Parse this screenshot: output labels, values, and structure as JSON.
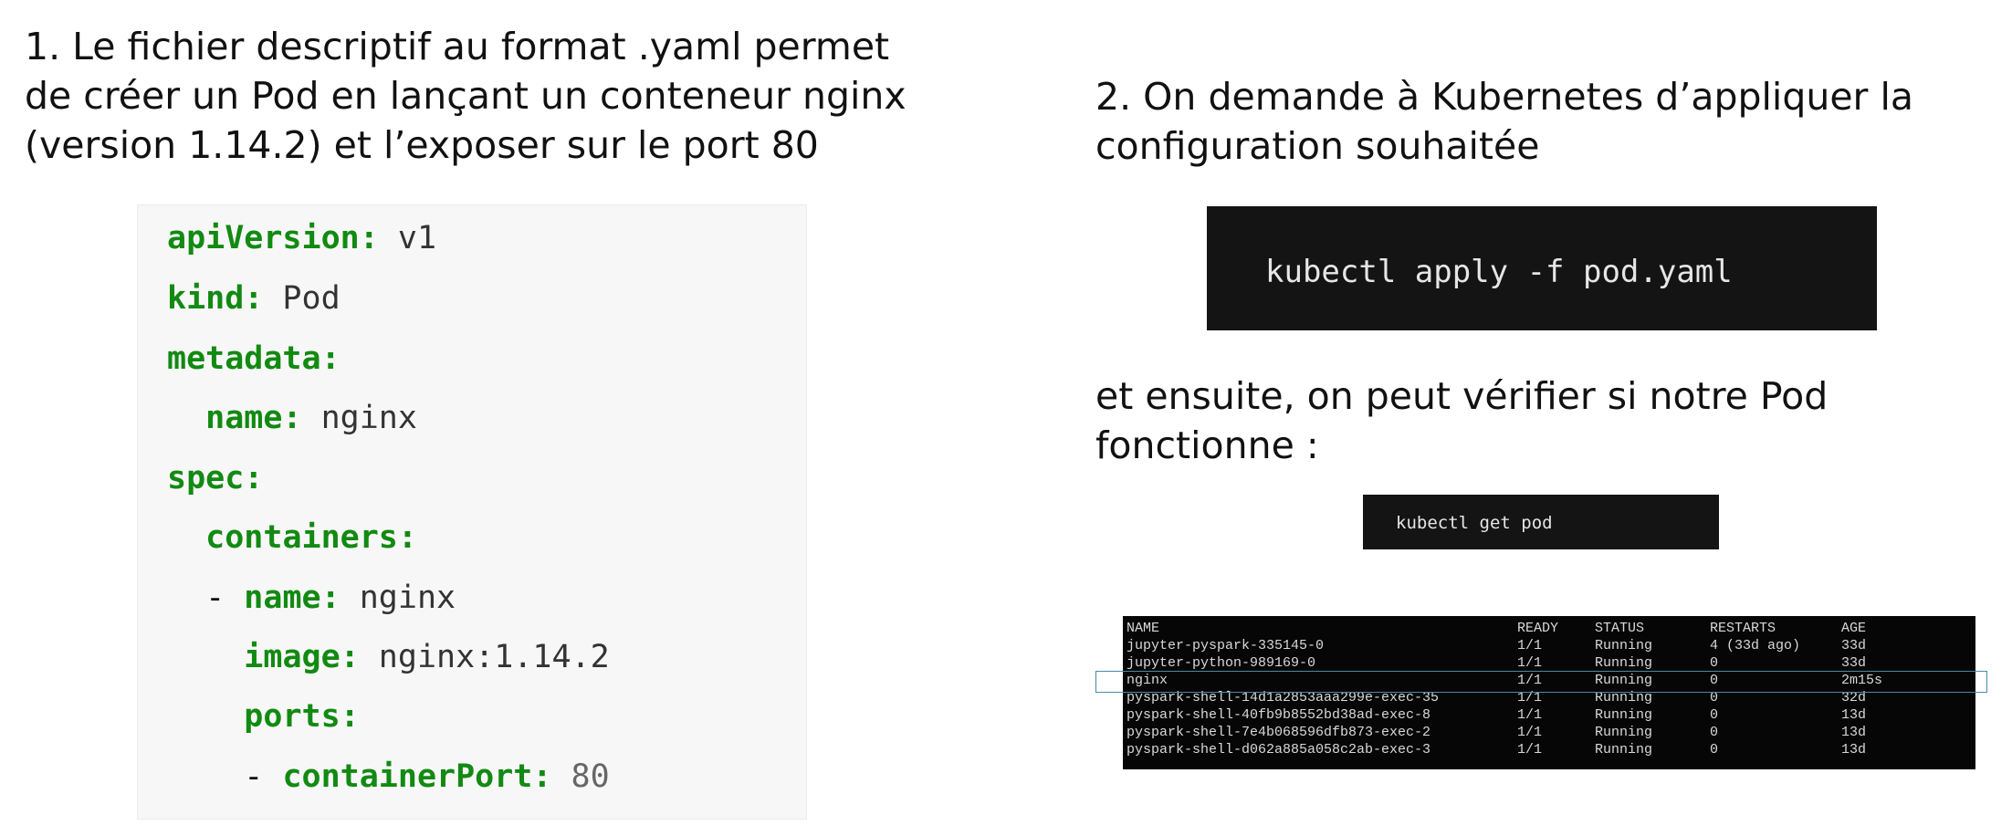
{
  "step1": {
    "lines": [
      "1. Le fichier descriptif au format .yaml permet",
      "de créer un Pod en lançant un conteneur nginx",
      "(version 1.14.2) et l’exposer sur le port 80"
    ]
  },
  "yaml": {
    "lines": [
      {
        "key": "apiVersion:",
        "value": " v1",
        "indent": ""
      },
      {
        "key": "kind:",
        "value": " Pod",
        "indent": ""
      },
      {
        "key": "metadata:",
        "value": "",
        "indent": ""
      },
      {
        "key": "name:",
        "value": " nginx",
        "indent": "  "
      },
      {
        "key": "spec:",
        "value": "",
        "indent": ""
      },
      {
        "key": "containers:",
        "value": "",
        "indent": "  "
      },
      {
        "key": "name:",
        "value": " nginx",
        "indent": "  - "
      },
      {
        "key": "image:",
        "value": " nginx:1.14.2",
        "indent": "    "
      },
      {
        "key": "ports:",
        "value": "",
        "indent": "    "
      },
      {
        "key": "containerPort:",
        "value": " 80",
        "indent": "    - "
      }
    ]
  },
  "step2": {
    "lines": [
      "2. On demande à Kubernetes d’appliquer la",
      "configuration souhaitée"
    ],
    "command": "kubectl apply -f pod.yaml"
  },
  "step3": {
    "lines": [
      "et ensuite, on peut vérifier si notre Pod",
      "fonctionne :"
    ],
    "command": "kubectl get pod"
  },
  "pod_table": {
    "headers": [
      "NAME",
      "READY",
      "STATUS",
      "RESTARTS",
      "AGE"
    ],
    "rows": [
      [
        "jupyter-pyspark-335145-0",
        "1/1",
        "Running",
        "4 (33d ago)",
        "33d"
      ],
      [
        "jupyter-python-989169-0",
        "1/1",
        "Running",
        "0",
        "33d"
      ],
      [
        "nginx",
        "1/1",
        "Running",
        "0",
        "2m15s"
      ],
      [
        "pyspark-shell-14d1a2853aaa299e-exec-35",
        "1/1",
        "Running",
        "0",
        "32d"
      ],
      [
        "pyspark-shell-40fb9b8552bd38ad-exec-8",
        "1/1",
        "Running",
        "0",
        "13d"
      ],
      [
        "pyspark-shell-7e4b068596dfb873-exec-2",
        "1/1",
        "Running",
        "0",
        "13d"
      ],
      [
        "pyspark-shell-d062a885a058c2ab-exec-3",
        "1/1",
        "Running",
        "0",
        "13d"
      ]
    ],
    "highlighted_row": "nginx"
  }
}
